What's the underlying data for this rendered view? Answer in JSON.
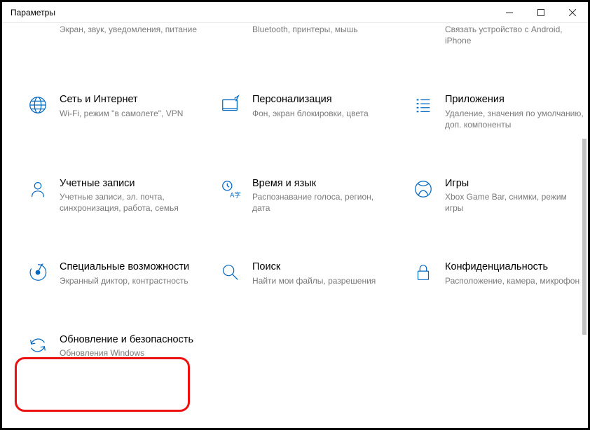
{
  "window": {
    "title": "Параметры"
  },
  "tiles": [
    {
      "title": "",
      "desc": "Экран, звук, уведомления, питание"
    },
    {
      "title": "",
      "desc": "Bluetooth, принтеры, мышь"
    },
    {
      "title": "",
      "desc": "Связать устройство с Android, iPhone"
    },
    {
      "title": "Сеть и Интернет",
      "desc": "Wi-Fi, режим \"в самолете\", VPN"
    },
    {
      "title": "Персонализация",
      "desc": "Фон, экран блокировки, цвета"
    },
    {
      "title": "Приложения",
      "desc": "Удаление, значения по умолчанию, доп. компоненты"
    },
    {
      "title": "Учетные записи",
      "desc": "Учетные записи, эл. почта, синхронизация, работа, семья"
    },
    {
      "title": "Время и язык",
      "desc": "Распознавание голоса, регион, дата"
    },
    {
      "title": "Игры",
      "desc": "Xbox Game Bar, снимки, режим игры"
    },
    {
      "title": "Специальные возможности",
      "desc": "Экранный диктор, контрастность"
    },
    {
      "title": "Поиск",
      "desc": "Найти мои файлы, разрешения"
    },
    {
      "title": "Конфиденциальность",
      "desc": "Расположение, камера, микрофон"
    },
    {
      "title": "Обновление и безопасность",
      "desc": "Обновления Windows"
    }
  ]
}
